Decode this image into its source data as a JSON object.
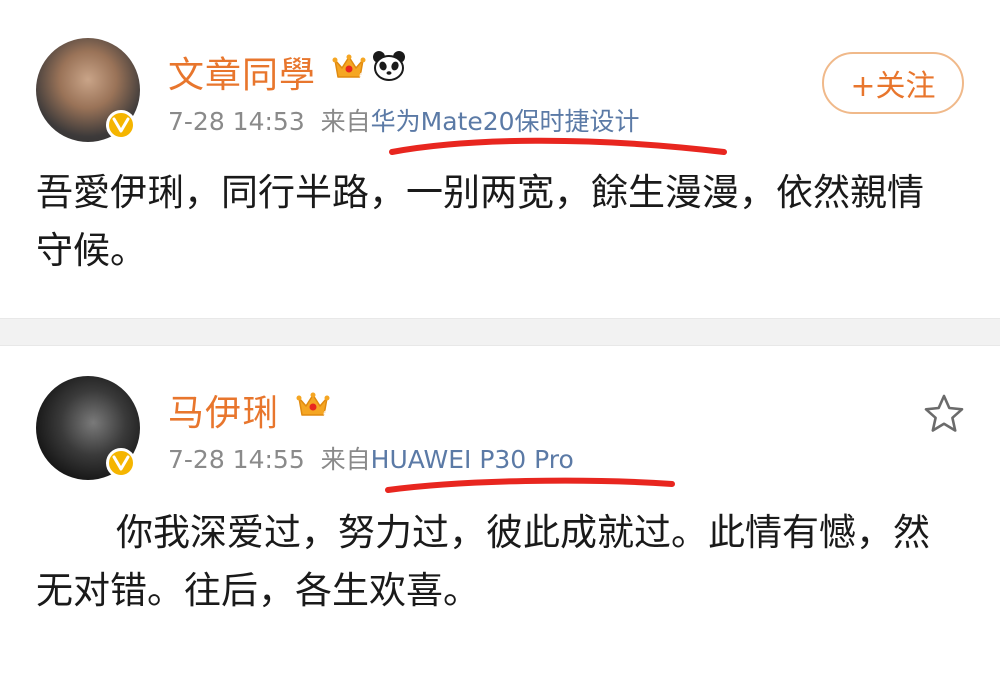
{
  "posts": [
    {
      "username": "文章同學",
      "time": "7-28 14:53",
      "source_prefix": "来自",
      "source_device": "华为Mate20保时捷设计",
      "follow_label": "+关注",
      "content": "吾愛伊琍，同行半路，一别两宽，餘生漫漫，依然親情守候。",
      "icons": [
        "avatar",
        "verified-badge-icon",
        "crown-vip-icon",
        "panda-icon"
      ]
    },
    {
      "username": "马伊琍",
      "time": "7-28 14:55",
      "source_prefix": "来自",
      "source_device": "HUAWEI P30 Pro",
      "content": "你我深爱过，努力过，彼此成就过。此情有憾，然无对错。往后，各生欢喜。",
      "icons": [
        "avatar",
        "verified-badge-icon",
        "crown-vip-icon",
        "star-icon"
      ]
    }
  ],
  "colors": {
    "username": "#e8762d",
    "meta": "#8a8a8a",
    "source_link": "#5b7aa6",
    "underline_annotation": "#e8261f",
    "verified_badge": "#f5b500",
    "follow_border": "#f0b98a"
  }
}
